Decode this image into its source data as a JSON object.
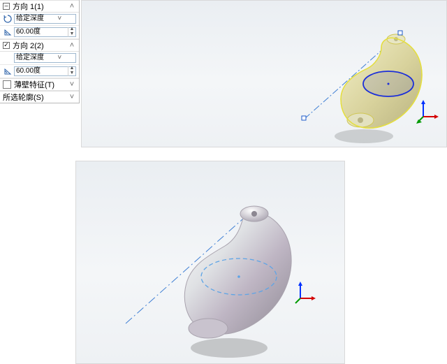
{
  "panel": {
    "group1": {
      "header": "方向 1(1)",
      "end_condition": "给定深度",
      "angle": "60.00度"
    },
    "group2": {
      "header": "方向 2(2)",
      "end_condition": "给定深度",
      "angle": "60.00度"
    },
    "thin_feature": "薄壁特征(T)",
    "contours": "所选轮廓(S)"
  },
  "icons": {
    "reverse": "↺",
    "angle": "↕",
    "collapse": "˄",
    "expand": "˅",
    "check": "",
    "dd": "˅",
    "up": "▲",
    "down": "▼"
  }
}
